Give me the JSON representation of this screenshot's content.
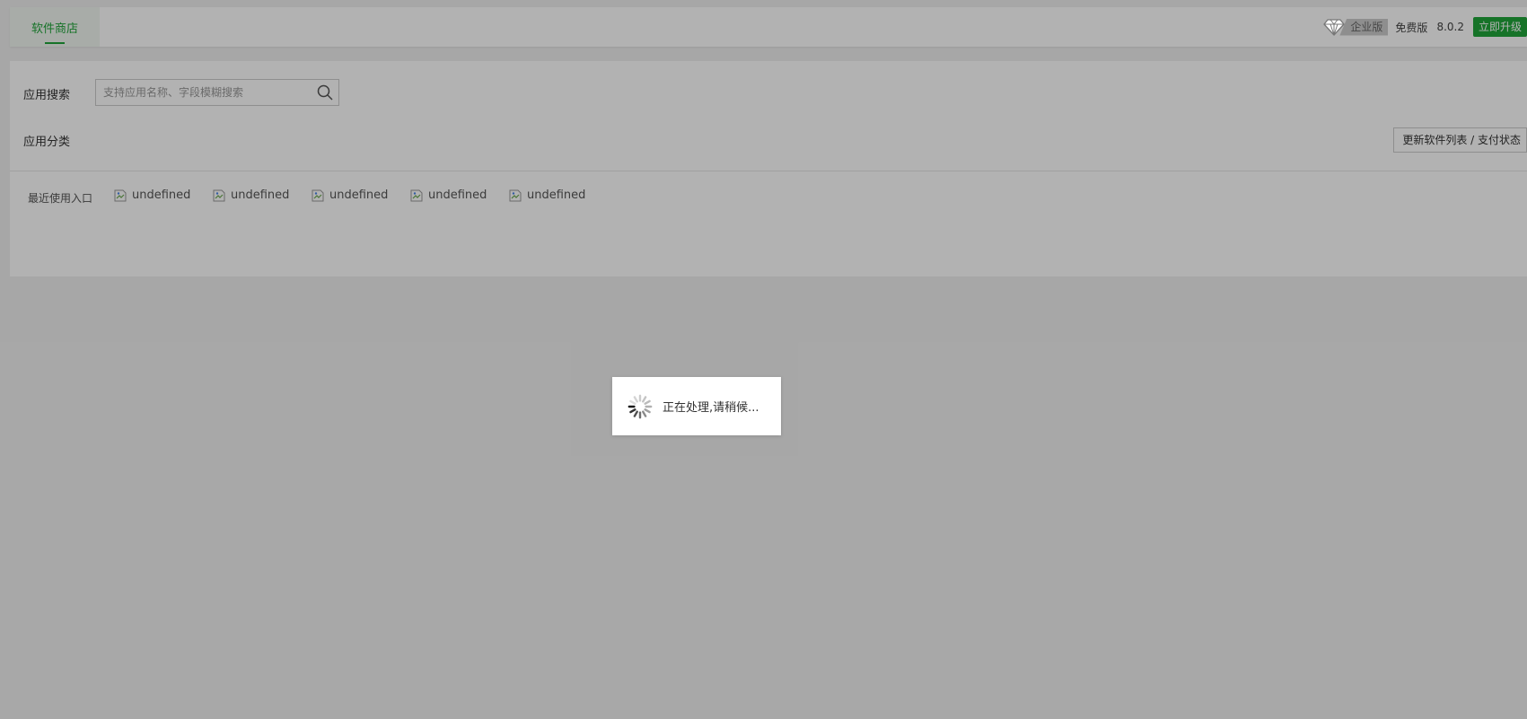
{
  "topbar": {
    "tab_label": "软件商店",
    "enterprise_label": "企业版",
    "edition_label": "免费版",
    "version": "8.0.2",
    "upgrade_label": "立即升级",
    "accent_color": "#20a53a"
  },
  "search": {
    "label": "应用搜索",
    "placeholder": "支持应用名称、字段模糊搜索"
  },
  "category": {
    "label": "应用分类",
    "update_button": "更新软件列表 / 支付状态"
  },
  "recent": {
    "label": "最近使用入口",
    "items": [
      {
        "name": "undefined"
      },
      {
        "name": "undefined"
      },
      {
        "name": "undefined"
      },
      {
        "name": "undefined"
      },
      {
        "name": "undefined"
      }
    ]
  },
  "loading": {
    "text": "正在处理,请稍候..."
  },
  "icons": {
    "diamond": "diamond-icon",
    "search": "search-icon",
    "broken_image": "broken-image-icon",
    "spinner": "spinner-icon"
  }
}
